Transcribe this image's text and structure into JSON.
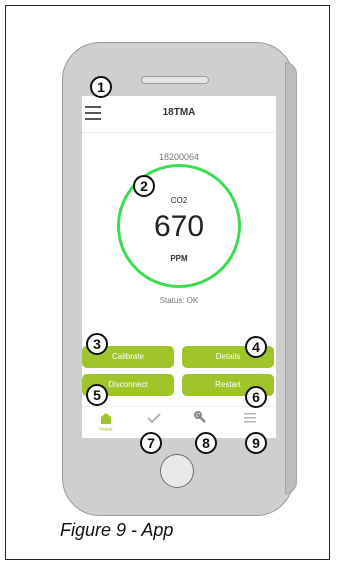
{
  "app": {
    "title": "18TMA",
    "device_id": "18200064",
    "gas": "CO2",
    "reading": "670",
    "unit": "PPM",
    "status": "Status: OK"
  },
  "buttons": {
    "calibrate": "Calibrate",
    "details": "Details",
    "disconnect": "Disconnect",
    "restart": "Restart"
  },
  "tabs": {
    "home_label": "Home"
  },
  "callouts": [
    "1",
    "2",
    "3",
    "4",
    "5",
    "6",
    "7",
    "8",
    "9"
  ],
  "caption": "Figure 9 - App",
  "colors": {
    "accent": "#9fc52a",
    "gauge_ring": "#3bdc4f"
  }
}
